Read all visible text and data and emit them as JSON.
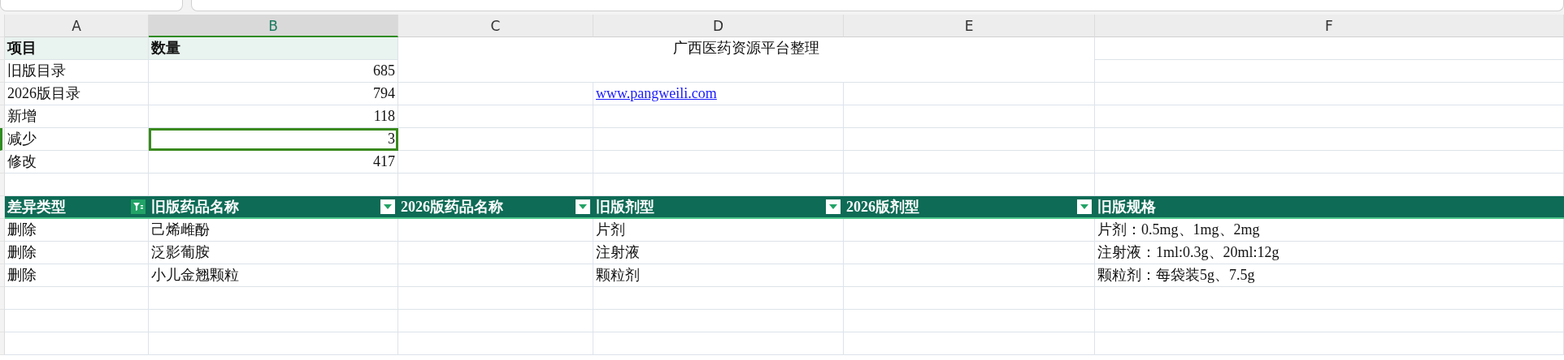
{
  "column_headers": [
    {
      "label": "A",
      "selected": false
    },
    {
      "label": "B",
      "selected": true
    },
    {
      "label": "C",
      "selected": false
    },
    {
      "label": "D",
      "selected": false
    },
    {
      "label": "E",
      "selected": false
    },
    {
      "label": "F",
      "selected": false
    }
  ],
  "summary": {
    "headers": [
      "项目",
      "数量"
    ],
    "rows": [
      {
        "item": "旧版目录",
        "count": "685",
        "selected": false
      },
      {
        "item": "2026版目录",
        "count": "794",
        "selected": false
      },
      {
        "item": "新增",
        "count": "118",
        "selected": false
      },
      {
        "item": "减少",
        "count": "3",
        "selected": true
      },
      {
        "item": "修改",
        "count": "417",
        "selected": false
      }
    ]
  },
  "title": "广西医药资源平台整理",
  "link": "www.pangweili.com",
  "table": {
    "columns": [
      {
        "label": "差异类型",
        "filtered": true
      },
      {
        "label": "旧版药品名称",
        "filtered": false
      },
      {
        "label": "2026版药品名称",
        "filtered": false
      },
      {
        "label": "旧版剂型",
        "filtered": false
      },
      {
        "label": "2026版剂型",
        "filtered": false
      },
      {
        "label": "旧版规格"
      }
    ],
    "rows": [
      [
        "删除",
        "己烯雌酚",
        null,
        "片剂",
        null,
        "片剂：0.5mg、1mg、2mg"
      ],
      [
        "删除",
        "泛影葡胺",
        null,
        "注射液",
        null,
        "注射液：1ml:0.3g、20ml:12g"
      ],
      [
        "删除",
        "小儿金翘颗粒",
        null,
        "颗粒剂",
        null,
        "颗粒剂：每袋装5g、7.5g"
      ]
    ]
  }
}
